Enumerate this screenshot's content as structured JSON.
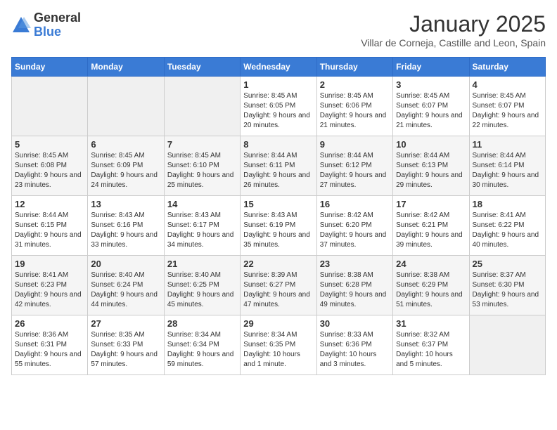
{
  "header": {
    "logo_line1": "General",
    "logo_line2": "Blue",
    "month_year": "January 2025",
    "location": "Villar de Corneja, Castille and Leon, Spain"
  },
  "weekdays": [
    "Sunday",
    "Monday",
    "Tuesday",
    "Wednesday",
    "Thursday",
    "Friday",
    "Saturday"
  ],
  "weeks": [
    [
      {
        "day": "",
        "info": ""
      },
      {
        "day": "",
        "info": ""
      },
      {
        "day": "",
        "info": ""
      },
      {
        "day": "1",
        "info": "Sunrise: 8:45 AM\nSunset: 6:05 PM\nDaylight: 9 hours and 20 minutes."
      },
      {
        "day": "2",
        "info": "Sunrise: 8:45 AM\nSunset: 6:06 PM\nDaylight: 9 hours and 21 minutes."
      },
      {
        "day": "3",
        "info": "Sunrise: 8:45 AM\nSunset: 6:07 PM\nDaylight: 9 hours and 21 minutes."
      },
      {
        "day": "4",
        "info": "Sunrise: 8:45 AM\nSunset: 6:07 PM\nDaylight: 9 hours and 22 minutes."
      }
    ],
    [
      {
        "day": "5",
        "info": "Sunrise: 8:45 AM\nSunset: 6:08 PM\nDaylight: 9 hours and 23 minutes."
      },
      {
        "day": "6",
        "info": "Sunrise: 8:45 AM\nSunset: 6:09 PM\nDaylight: 9 hours and 24 minutes."
      },
      {
        "day": "7",
        "info": "Sunrise: 8:45 AM\nSunset: 6:10 PM\nDaylight: 9 hours and 25 minutes."
      },
      {
        "day": "8",
        "info": "Sunrise: 8:44 AM\nSunset: 6:11 PM\nDaylight: 9 hours and 26 minutes."
      },
      {
        "day": "9",
        "info": "Sunrise: 8:44 AM\nSunset: 6:12 PM\nDaylight: 9 hours and 27 minutes."
      },
      {
        "day": "10",
        "info": "Sunrise: 8:44 AM\nSunset: 6:13 PM\nDaylight: 9 hours and 29 minutes."
      },
      {
        "day": "11",
        "info": "Sunrise: 8:44 AM\nSunset: 6:14 PM\nDaylight: 9 hours and 30 minutes."
      }
    ],
    [
      {
        "day": "12",
        "info": "Sunrise: 8:44 AM\nSunset: 6:15 PM\nDaylight: 9 hours and 31 minutes."
      },
      {
        "day": "13",
        "info": "Sunrise: 8:43 AM\nSunset: 6:16 PM\nDaylight: 9 hours and 33 minutes."
      },
      {
        "day": "14",
        "info": "Sunrise: 8:43 AM\nSunset: 6:17 PM\nDaylight: 9 hours and 34 minutes."
      },
      {
        "day": "15",
        "info": "Sunrise: 8:43 AM\nSunset: 6:19 PM\nDaylight: 9 hours and 35 minutes."
      },
      {
        "day": "16",
        "info": "Sunrise: 8:42 AM\nSunset: 6:20 PM\nDaylight: 9 hours and 37 minutes."
      },
      {
        "day": "17",
        "info": "Sunrise: 8:42 AM\nSunset: 6:21 PM\nDaylight: 9 hours and 39 minutes."
      },
      {
        "day": "18",
        "info": "Sunrise: 8:41 AM\nSunset: 6:22 PM\nDaylight: 9 hours and 40 minutes."
      }
    ],
    [
      {
        "day": "19",
        "info": "Sunrise: 8:41 AM\nSunset: 6:23 PM\nDaylight: 9 hours and 42 minutes."
      },
      {
        "day": "20",
        "info": "Sunrise: 8:40 AM\nSunset: 6:24 PM\nDaylight: 9 hours and 44 minutes."
      },
      {
        "day": "21",
        "info": "Sunrise: 8:40 AM\nSunset: 6:25 PM\nDaylight: 9 hours and 45 minutes."
      },
      {
        "day": "22",
        "info": "Sunrise: 8:39 AM\nSunset: 6:27 PM\nDaylight: 9 hours and 47 minutes."
      },
      {
        "day": "23",
        "info": "Sunrise: 8:38 AM\nSunset: 6:28 PM\nDaylight: 9 hours and 49 minutes."
      },
      {
        "day": "24",
        "info": "Sunrise: 8:38 AM\nSunset: 6:29 PM\nDaylight: 9 hours and 51 minutes."
      },
      {
        "day": "25",
        "info": "Sunrise: 8:37 AM\nSunset: 6:30 PM\nDaylight: 9 hours and 53 minutes."
      }
    ],
    [
      {
        "day": "26",
        "info": "Sunrise: 8:36 AM\nSunset: 6:31 PM\nDaylight: 9 hours and 55 minutes."
      },
      {
        "day": "27",
        "info": "Sunrise: 8:35 AM\nSunset: 6:33 PM\nDaylight: 9 hours and 57 minutes."
      },
      {
        "day": "28",
        "info": "Sunrise: 8:34 AM\nSunset: 6:34 PM\nDaylight: 9 hours and 59 minutes."
      },
      {
        "day": "29",
        "info": "Sunrise: 8:34 AM\nSunset: 6:35 PM\nDaylight: 10 hours and 1 minute."
      },
      {
        "day": "30",
        "info": "Sunrise: 8:33 AM\nSunset: 6:36 PM\nDaylight: 10 hours and 3 minutes."
      },
      {
        "day": "31",
        "info": "Sunrise: 8:32 AM\nSunset: 6:37 PM\nDaylight: 10 hours and 5 minutes."
      },
      {
        "day": "",
        "info": ""
      }
    ]
  ]
}
